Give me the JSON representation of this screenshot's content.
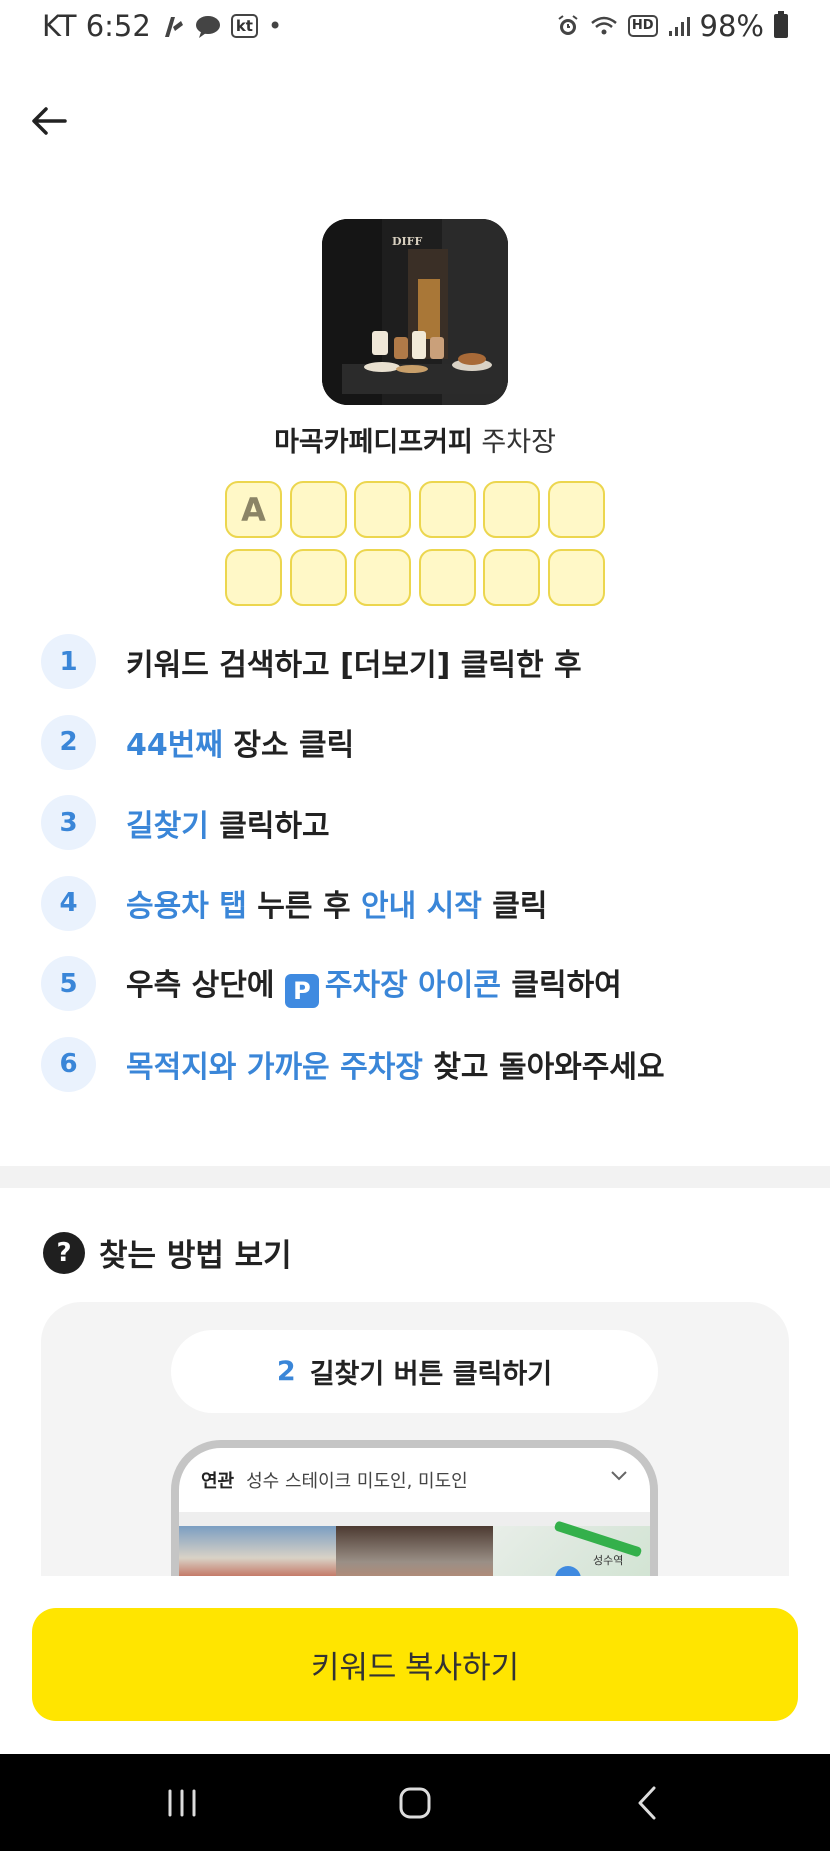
{
  "status_bar": {
    "carrier_time": "KT 6:52",
    "kt_badge": "kt",
    "hd_badge": "HD",
    "battery": "98%"
  },
  "header": {
    "place_name": "마곡카페디프커피",
    "place_suffix": "주차장",
    "thumbnail_sign": "DIFF"
  },
  "answer_grid": {
    "cells": [
      "A",
      "",
      "",
      "",
      "",
      "",
      "",
      "",
      "",
      "",
      "",
      ""
    ]
  },
  "steps": [
    {
      "num": "1",
      "parts": [
        {
          "t": "키워드 검색하고 [더보기] 클릭한 후",
          "hl": false
        }
      ]
    },
    {
      "num": "2",
      "parts": [
        {
          "t": "44번째",
          "hl": true
        },
        {
          "t": " 장소 클릭",
          "hl": false
        }
      ]
    },
    {
      "num": "3",
      "parts": [
        {
          "t": "길찾기",
          "hl": true
        },
        {
          "t": " 클릭하고",
          "hl": false
        }
      ]
    },
    {
      "num": "4",
      "parts": [
        {
          "t": "승용차 탭",
          "hl": true
        },
        {
          "t": " 누른 후 ",
          "hl": false
        },
        {
          "t": "안내 시작",
          "hl": true
        },
        {
          "t": " 클릭",
          "hl": false
        }
      ]
    },
    {
      "num": "5",
      "parts": [
        {
          "t": "우측 상단에 ",
          "hl": false
        },
        {
          "t": "P",
          "icon": true
        },
        {
          "t": "주차장 아이콘",
          "hl": true
        },
        {
          "t": " 클릭하여",
          "hl": false
        }
      ]
    },
    {
      "num": "6",
      "parts": [
        {
          "t": "목적지와 가까운 주차장",
          "hl": true
        },
        {
          "t": " 찾고 돌아와주세요",
          "hl": false
        }
      ]
    }
  ],
  "howto": {
    "icon": "?",
    "title": "찾는 방법 보기",
    "pill_num": "2",
    "pill_text": "길찾기 버튼 클릭하기",
    "phone_tag": "연관",
    "phone_query": "성수 스테이크 미도인, 미도인",
    "map_label": "성수역"
  },
  "copy_button": "키워드 복사하기",
  "colors": {
    "accent_blue": "#3a86d8",
    "yellow_button": "#ffe500",
    "cell_fill": "#fff8c7",
    "cell_border": "#ecd64e"
  }
}
